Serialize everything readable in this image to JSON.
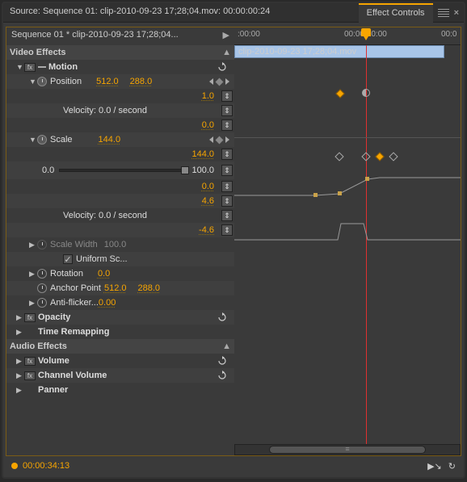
{
  "tabs": {
    "source": "Source: Sequence 01: clip-2010-09-23 17;28;04.mov: 00:00:00:24",
    "effect_controls": "Effect Controls"
  },
  "header": {
    "sequence_clip": "Sequence 01 * clip-2010-09-23 17;28;04..."
  },
  "sections": {
    "video_effects": "Video Effects",
    "audio_effects": "Audio Effects"
  },
  "motion": {
    "name": "Motion",
    "position": {
      "name": "Position",
      "x": "512.0",
      "y": "288.0",
      "graph_max": "1.0",
      "graph_min": "0.0",
      "velocity": "Velocity: 0.0 / second"
    },
    "scale": {
      "name": "Scale",
      "value": "144.0",
      "graph_max": "144.0",
      "graph_min": "0.0",
      "slider_min": "0.0",
      "slider_max": "100.0",
      "vel_max": "4.6",
      "vel_min": "-4.6",
      "velocity": "Velocity: 0.0 / second"
    },
    "scale_width": {
      "name": "Scale Width",
      "value": "100.0"
    },
    "uniform_scale": "Uniform Sc...",
    "rotation": {
      "name": "Rotation",
      "value": "0.0"
    },
    "anchor": {
      "name": "Anchor Point",
      "x": "512.0",
      "y": "288.0"
    },
    "anti_flicker": {
      "name": "Anti-flicker...",
      "value": "0.00"
    }
  },
  "opacity": {
    "name": "Opacity"
  },
  "time_remap": {
    "name": "Time Remapping"
  },
  "audio": {
    "volume": "Volume",
    "channel_volume": "Channel Volume",
    "panner": "Panner"
  },
  "timeline": {
    "ticks": [
      ":00:00",
      "00:00:30:00",
      "00:0"
    ],
    "clip_name": "clip-2010-09-23 17;28;04.mov"
  },
  "status": {
    "timecode": "00:00:34:13"
  }
}
